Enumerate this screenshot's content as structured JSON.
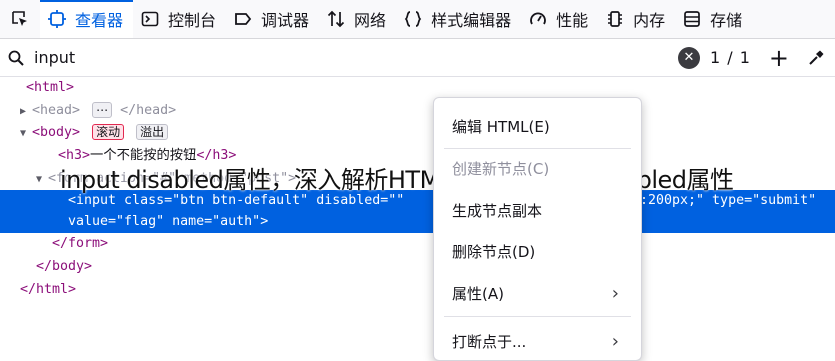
{
  "toolbar": {
    "tabs": [
      {
        "label": "查看器",
        "icon": "inspector-icon",
        "active": true
      },
      {
        "label": "控制台",
        "icon": "console-icon"
      },
      {
        "label": "调试器",
        "icon": "debugger-icon"
      },
      {
        "label": "网络",
        "icon": "network-icon"
      },
      {
        "label": "样式编辑器",
        "icon": "style-editor-icon"
      },
      {
        "label": "性能",
        "icon": "performance-icon"
      },
      {
        "label": "内存",
        "icon": "memory-icon"
      },
      {
        "label": "存储",
        "icon": "storage-icon"
      }
    ],
    "accent": "#0061e0"
  },
  "search": {
    "value": "input",
    "clear": "✕",
    "count": "1 / 1",
    "add": "+"
  },
  "tree": {
    "html_open": "<html>",
    "head": {
      "open": "<head>",
      "ellipsis": "⋯",
      "close": "</head>"
    },
    "body_open": "<body>",
    "badges": {
      "scroll": "滚动",
      "overflow": "溢出"
    },
    "h3": {
      "open": "<h3>",
      "text": "一个不能按的按钮",
      "close": "</h3>"
    },
    "form_line": "<form action=\"#\" method=\"post\">",
    "input_line1": {
      "tag_open": "<input",
      "attr1_name": " class=",
      "attr1_val": "\"btn btn-default\"",
      "attr2_name": " disabled=",
      "attr2_val": "\"\"",
      "tail": ":200px;\"",
      "attr3_name": " type=",
      "attr3_val": "\"submit\""
    },
    "input_line2": {
      "attr4_name": "value=",
      "attr4_val": "\"flag\"",
      "attr5_name": " name=",
      "attr5_val": "\"auth\"",
      "close": ">"
    },
    "form_close": "</form>",
    "body_close": "</body>",
    "html_close": "</html>"
  },
  "overlay_title": "input disabled属性，深入解析HTML input元素的disabled属性",
  "context_menu": {
    "items": [
      {
        "label": "编辑 HTML(E)"
      },
      {
        "label": "创建新节点(C)",
        "disabled": true
      },
      {
        "label": "生成节点副本"
      },
      {
        "label": "删除节点(D)"
      },
      {
        "label": "属性(A)",
        "submenu": "›"
      },
      {
        "label": "打断点于...",
        "submenu": "›"
      }
    ]
  }
}
